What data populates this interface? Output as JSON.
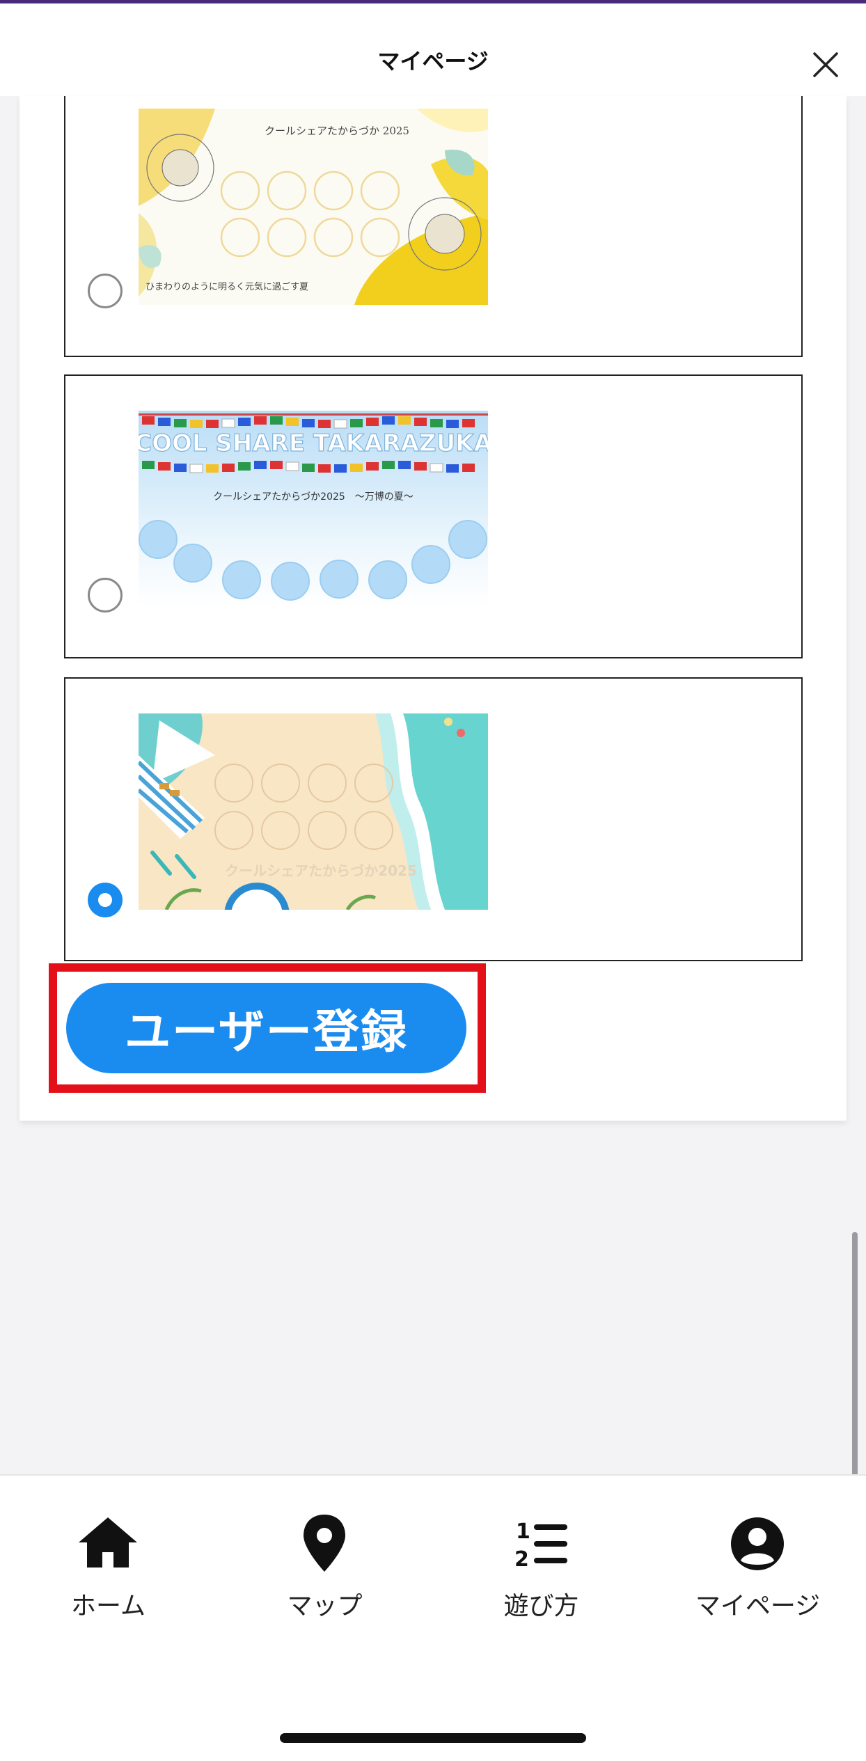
{
  "header": {
    "title": "マイページ",
    "close_icon": "close-icon"
  },
  "cards": [
    {
      "theme": "sunflower",
      "title": "クールシェアたからづか 2025",
      "caption": "ひまわりのように明るく元気に過ごす夏",
      "selected": false
    },
    {
      "theme": "flags",
      "banner": "COOL SHARE TAKARAZUKA",
      "title": "クールシェアたからづか2025　～万博の夏～",
      "selected": false
    },
    {
      "theme": "beach",
      "title": "クールシェアたからづか2025",
      "selected": true
    }
  ],
  "actions": {
    "register_label": "ユーザー登録"
  },
  "nav": {
    "items": [
      {
        "label": "ホーム",
        "icon": "home-icon"
      },
      {
        "label": "マップ",
        "icon": "map-pin-icon"
      },
      {
        "label": "遊び方",
        "icon": "numbered-list-icon"
      },
      {
        "label": "マイページ",
        "icon": "user-circle-icon"
      }
    ]
  },
  "colors": {
    "accent": "#1a8cf0",
    "highlight": "#e3101a"
  }
}
